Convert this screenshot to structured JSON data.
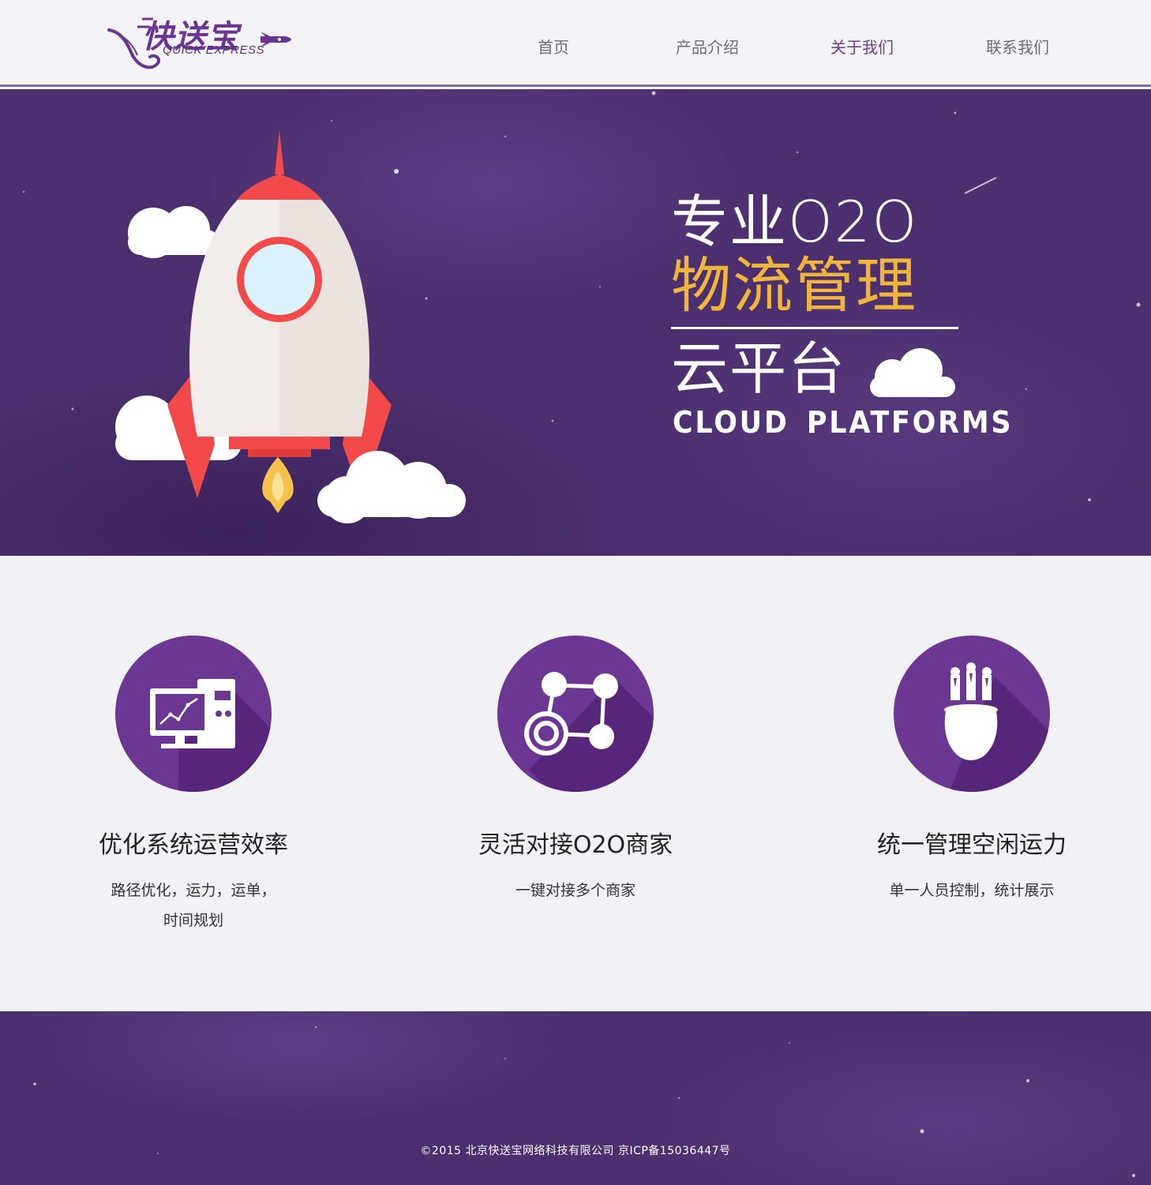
{
  "header": {
    "logo": {
      "name_cn": "快送宝",
      "name_en": "QUICK EXPRESS"
    },
    "nav": [
      {
        "label": "首页",
        "active": false
      },
      {
        "label": "产品介绍",
        "active": false
      },
      {
        "label": "关于我们",
        "active": true
      },
      {
        "label": "联系我们",
        "active": false
      }
    ]
  },
  "banner": {
    "line1": "专业O2O",
    "line2": "物流管理",
    "line3": "云平台",
    "line4": "CLOUD PLATFORMS"
  },
  "features": [
    {
      "icon": "monitor-chart-icon",
      "title": "优化系统运营效率",
      "desc": [
        "路径优化，运力，运单，",
        "时间规划"
      ]
    },
    {
      "icon": "network-nodes-icon",
      "title": "灵活对接O2O商家",
      "desc": [
        "一键对接多个商家"
      ]
    },
    {
      "icon": "head-people-icon",
      "title": "统一管理空闲运力",
      "desc": [
        "单一人员控制，统计展示"
      ]
    }
  ],
  "footer": {
    "copyright": "©2015 北京快送宝网络科技有限公司   京ICP备15036447号"
  },
  "colors": {
    "brand_purple": "#6b3793",
    "banner_bg": "#4b2f6e",
    "headline_gold": "#f0b53a",
    "nav_active": "#6d3a98",
    "rocket_red": "#f24a4a"
  }
}
